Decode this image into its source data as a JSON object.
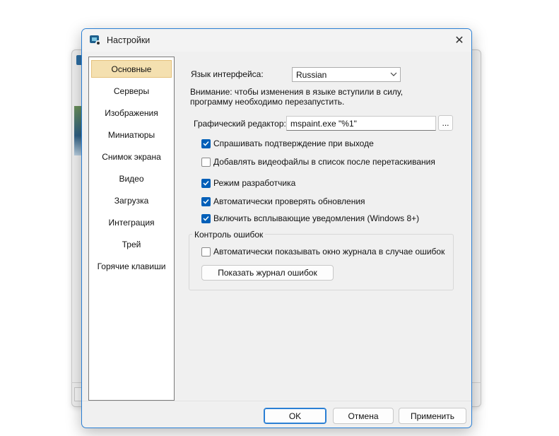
{
  "window": {
    "title": "Настройки",
    "close_glyph": "✕"
  },
  "nav": {
    "items": [
      {
        "label": "Основные",
        "active": true
      },
      {
        "label": "Серверы"
      },
      {
        "label": "Изображения"
      },
      {
        "label": "Миниатюры"
      },
      {
        "label": "Снимок экрана"
      },
      {
        "label": "Видео"
      },
      {
        "label": "Загрузка"
      },
      {
        "label": "Интеграция"
      },
      {
        "label": "Трей"
      },
      {
        "label": "Горячие клавиши"
      }
    ]
  },
  "general": {
    "language_label": "Язык интерфейса:",
    "language_value": "Russian",
    "notice": "Внимание: чтобы изменения в языке вступили в силу, программу необходимо перезапустить.",
    "editor_label": "Графический редактор:",
    "editor_value": "mspaint.exe \"%1\"",
    "browse_label": "...",
    "options": [
      {
        "label": "Спрашивать подтверждение при выходе",
        "checked": true
      },
      {
        "label": "Добавлять видеофайлы в список после перетаскивания",
        "checked": false
      },
      {
        "label": "Режим разработчика",
        "checked": true
      },
      {
        "label": "Автоматически проверять обновления",
        "checked": true
      },
      {
        "label": "Включить всплывающие уведомления (Windows 8+)",
        "checked": true
      }
    ]
  },
  "error_control": {
    "title": "Контроль ошибок",
    "auto_show_label": "Автоматически показывать окно журнала в случае ошибок",
    "auto_show_checked": false,
    "show_log_button": "Показать журнал ошибок"
  },
  "footer": {
    "ok": "OK",
    "cancel": "Отмена",
    "apply": "Применить"
  },
  "colors": {
    "accent": "#005fb8",
    "active_nav": "#f4e0b0",
    "dialog_border": "#2a7fd4"
  },
  "icons": [
    "app-icon",
    "close-icon",
    "chevron-down-icon",
    "checkmark-icon"
  ]
}
